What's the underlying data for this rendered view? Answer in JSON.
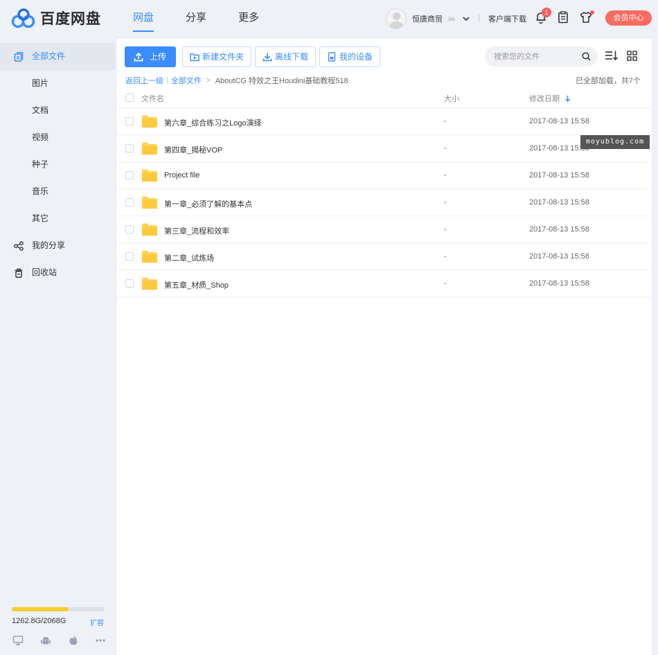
{
  "brand": {
    "name": "百度网盘"
  },
  "nav": {
    "items": [
      "网盘",
      "分享",
      "更多"
    ],
    "active_index": 0
  },
  "topbar": {
    "username": "恒唐商贸",
    "client_download": "客户端下载",
    "notification_count": "1",
    "vip_button": "会员中心"
  },
  "sidebar": {
    "items": [
      {
        "label": "全部文件",
        "icon": "all-files-icon",
        "active": true
      },
      {
        "label": "图片"
      },
      {
        "label": "文档"
      },
      {
        "label": "视频"
      },
      {
        "label": "种子"
      },
      {
        "label": "音乐"
      },
      {
        "label": "其它"
      },
      {
        "label": "我的分享",
        "icon": "share-icon"
      },
      {
        "label": "回收站",
        "icon": "trash-icon"
      }
    ],
    "quota": {
      "used_fraction": 0.61,
      "text": "1262.8G/2068G",
      "expand_label": "扩容"
    },
    "devices": [
      "desktop-icon",
      "android-icon",
      "apple-icon",
      "more-icon"
    ]
  },
  "toolbar": {
    "upload": "上传",
    "new_folder": "新建文件夹",
    "offline_download": "离线下载",
    "my_devices": "我的设备",
    "search_placeholder": "搜索您的文件"
  },
  "breadcrumb": {
    "back": "返回上一级",
    "all_files": "全部文件",
    "current": "AboutCG 特效之王Houdini基础教程518"
  },
  "load_status": "已全部加载，共7个",
  "table": {
    "headers": {
      "name": "文件名",
      "size": "大小",
      "date": "修改日期"
    },
    "rows": [
      {
        "name": "第六章_综合练习之Logo演绎",
        "size": "-",
        "date": "2017-08-13 15:58"
      },
      {
        "name": "第四章_揭秘VOP",
        "size": "-",
        "date": "2017-08-13 15:58"
      },
      {
        "name": "Project file",
        "size": "-",
        "date": "2017-08-13 15:58"
      },
      {
        "name": "第一章_必须了解的基本点",
        "size": "-",
        "date": "2017-08-13 15:58"
      },
      {
        "name": "第三章_流程和效率",
        "size": "-",
        "date": "2017-08-13 15:58"
      },
      {
        "name": "第二章_试炼场",
        "size": "-",
        "date": "2017-08-13 15:58"
      },
      {
        "name": "第五章_材质_Shop",
        "size": "-",
        "date": "2017-08-13 15:58"
      }
    ]
  },
  "watermark": "moyublog.com",
  "colors": {
    "accent": "#3b8cff",
    "vip": "#f86b61",
    "quota": "#f6cd2b",
    "folder": "#ffd35c"
  }
}
